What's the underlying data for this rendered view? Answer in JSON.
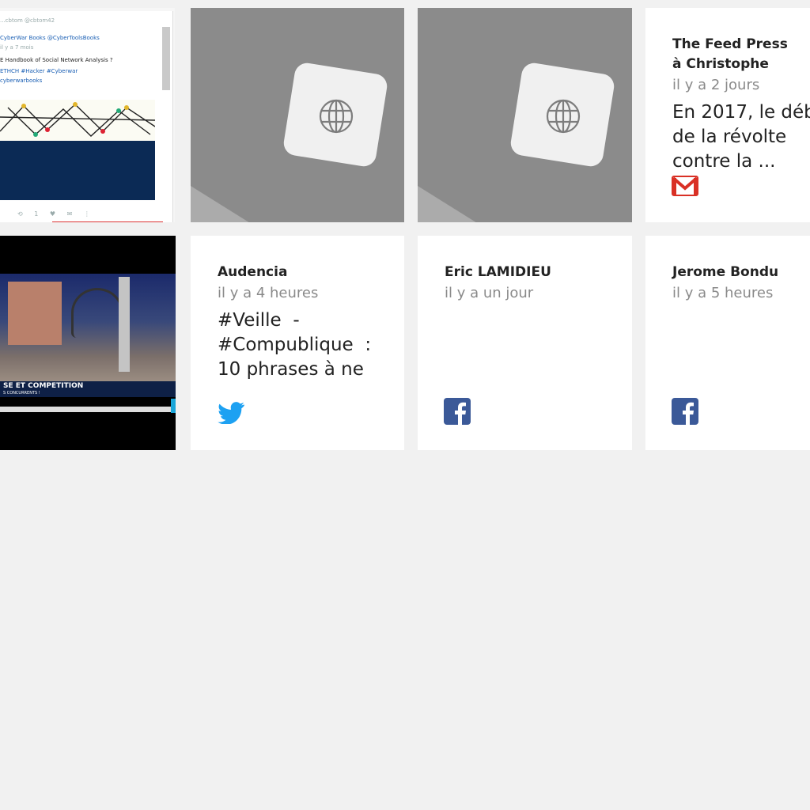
{
  "tweet_shot": {
    "handle": "...cbtom  @cbtom42",
    "account": "CyberWar Books @CyberToolsBooks",
    "time": "il y a 7 mois",
    "text1": "E Handbook of Social Network Analysis ?",
    "text2": "ETHCH #Hacker #Cyberwar",
    "text3": "cyberwarbooks",
    "actions": "⟲ 1   ♥   ✉   ⋮"
  },
  "placeholder_icon": "globe-icon",
  "cards": [
    {
      "author_line1": "The Feed Press",
      "author_line2": "à Christophe",
      "time": "il y a 2 jours",
      "snippet": "En 2017, le déb\nde la révolte\ncontre la ...",
      "source_icon": "gmail-icon",
      "source_color": "#d93025"
    },
    {
      "author": "Audencia",
      "time": "il y a 4 heures",
      "snippet": "#Veille  -\n#Compublique  :\n10 phrases à ne",
      "source_icon": "twitter-icon",
      "source_color": "#1da1f2"
    },
    {
      "author": "Eric LAMIDIEU",
      "time": "il y a un jour",
      "snippet": "",
      "source_icon": "facebook-icon",
      "source_color": "#3b5998"
    },
    {
      "author": "Jerome Bondu",
      "time": "il y a 5 heures",
      "snippet": "",
      "source_icon": "facebook-icon",
      "source_color": "#3b5998"
    }
  ],
  "video": {
    "banner": "SE ET COMPETITION",
    "banner_small": "S CONCURRENTS !"
  }
}
